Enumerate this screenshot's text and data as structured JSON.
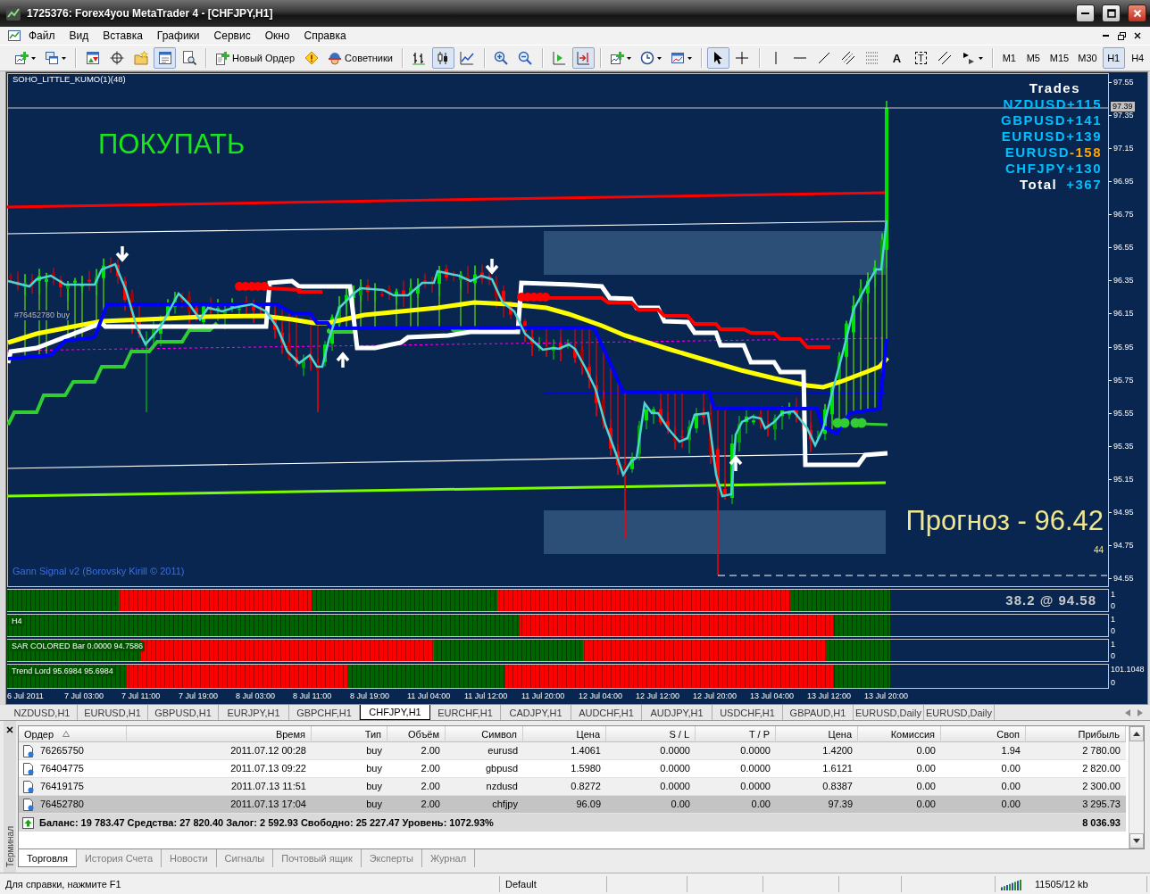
{
  "window": {
    "title": "1725376: Forex4you MetaTrader 4 - [CHFJPY,H1]"
  },
  "menu": [
    "Файл",
    "Вид",
    "Вставка",
    "Графики",
    "Сервис",
    "Окно",
    "Справка"
  ],
  "toolbar": {
    "panels": [
      {
        "kind": "market_watch",
        "selected": false
      },
      {
        "kind": "data_window",
        "selected": false
      },
      {
        "kind": "navigator",
        "selected": false
      },
      {
        "kind": "terminal",
        "selected": true
      },
      {
        "kind": "tester",
        "selected": false
      }
    ],
    "new_order": "Новый Ордер",
    "experts": "Советники",
    "chart_types": [
      {
        "kind": "bars",
        "selected": false
      },
      {
        "kind": "candles",
        "selected": true
      },
      {
        "kind": "line",
        "selected": false
      }
    ],
    "chart_options": [
      {
        "kind": "shift",
        "selected": false
      },
      {
        "kind": "autoscroll",
        "selected": true
      }
    ],
    "draw_tools": [
      {
        "kind": "cursor",
        "selected": true
      },
      {
        "kind": "crosshair",
        "selected": false
      },
      {
        "kind": "vline",
        "selected": false
      },
      {
        "kind": "hline",
        "selected": false
      },
      {
        "kind": "trendline",
        "selected": false
      },
      {
        "kind": "channel",
        "selected": false
      },
      {
        "kind": "fibo",
        "selected": false
      },
      {
        "kind": "text",
        "label": "A",
        "selected": false
      },
      {
        "kind": "label",
        "label": "T",
        "selected": false
      },
      {
        "kind": "hatch",
        "selected": false
      },
      {
        "kind": "shapes",
        "selected": false
      }
    ],
    "timeframes": [
      {
        "label": "M1",
        "selected": false
      },
      {
        "label": "M5",
        "selected": false
      },
      {
        "label": "M15",
        "selected": false
      },
      {
        "label": "M30",
        "selected": false
      },
      {
        "label": "H1",
        "selected": true
      },
      {
        "label": "H4",
        "selected": false
      }
    ]
  },
  "chart": {
    "indicator_title": "SOHO_LITTLE_KUMO(1)(48)",
    "signal": "ПОКУПАТЬ",
    "order_label": "#76452780 buy",
    "trades": {
      "title": "Trades",
      "rows": [
        {
          "pair": "NZDUSD",
          "value": "+115",
          "color": "#00bfff"
        },
        {
          "pair": "GBPUSD",
          "value": "+141",
          "color": "#00bfff"
        },
        {
          "pair": "EURUSD",
          "value": "+139",
          "color": "#00bfff"
        },
        {
          "pair": "EURUSD",
          "value": "-158",
          "color": "#ffa500"
        },
        {
          "pair": "CHFJPY",
          "value": "+130",
          "color": "#00bfff"
        }
      ],
      "total": {
        "label": "Total",
        "value": "+367"
      }
    },
    "forecast": "Прогноз - 96.42",
    "forecast_count": "44",
    "credit": "Gann Signal v2 (Borovsky Kirill © 2011)",
    "current_price": "97.39",
    "price_axis": [
      "97.55",
      "97.35",
      "97.15",
      "96.95",
      "96.75",
      "96.55",
      "96.35",
      "96.15",
      "95.95",
      "95.75",
      "95.55",
      "95.35",
      "95.15",
      "94.95",
      "94.75",
      "94.55"
    ]
  },
  "subwindows": [
    {
      "note": "38.2 @ 94.58",
      "axis": [
        "1",
        "0"
      ]
    },
    {
      "label": "H4",
      "axis": [
        "1",
        "0"
      ]
    },
    {
      "label": "SAR COLORED Bar 0.0000 94.7586",
      "axis": [
        "1",
        "0"
      ]
    },
    {
      "label": "Trend Lord 95.6984 95.6984",
      "axis": [
        "101.1048",
        "0"
      ]
    }
  ],
  "time_axis": [
    "6 Jul 2011",
    "7 Jul 03:00",
    "7 Jul 11:00",
    "7 Jul 19:00",
    "8 Jul 03:00",
    "8 Jul 11:00",
    "8 Jul 19:00",
    "11 Jul 04:00",
    "11 Jul 12:00",
    "11 Jul 20:00",
    "12 Jul 04:00",
    "12 Jul 12:00",
    "12 Jul 20:00",
    "13 Jul 04:00",
    "13 Jul 12:00",
    "13 Jul 20:00"
  ],
  "chart_tabs": [
    {
      "label": "NZDUSD,H1",
      "selected": false
    },
    {
      "label": "EURUSD,H1",
      "selected": false
    },
    {
      "label": "GBPUSD,H1",
      "selected": false
    },
    {
      "label": "EURJPY,H1",
      "selected": false
    },
    {
      "label": "GBPCHF,H1",
      "selected": false
    },
    {
      "label": "CHFJPY,H1",
      "selected": true
    },
    {
      "label": "EURCHF,H1",
      "selected": false
    },
    {
      "label": "CADJPY,H1",
      "selected": false
    },
    {
      "label": "AUDCHF,H1",
      "selected": false
    },
    {
      "label": "AUDJPY,H1",
      "selected": false
    },
    {
      "label": "USDCHF,H1",
      "selected": false
    },
    {
      "label": "GBPAUD,H1",
      "selected": false
    },
    {
      "label": "EURUSD,Daily",
      "selected": false
    },
    {
      "label": "EURUSD,Daily",
      "selected": false
    }
  ],
  "terminal": {
    "title": "Терминал",
    "columns": [
      {
        "label": "Ордер",
        "sorted": true
      },
      {
        "label": "Время",
        "sorted": false
      },
      {
        "label": "Тип",
        "sorted": false
      },
      {
        "label": "Объём",
        "sorted": false
      },
      {
        "label": "Символ",
        "sorted": false
      },
      {
        "label": "Цена",
        "sorted": false
      },
      {
        "label": "S / L",
        "sorted": false
      },
      {
        "label": "T / P",
        "sorted": false
      },
      {
        "label": "Цена",
        "sorted": false
      },
      {
        "label": "Комиссия",
        "sorted": false
      },
      {
        "label": "Своп",
        "sorted": false
      },
      {
        "label": "Прибыль",
        "sorted": false
      }
    ],
    "rows": [
      {
        "cells": [
          "76265750",
          "2011.07.12 00:28",
          "buy",
          "2.00",
          "eurusd",
          "1.4061",
          "0.0000",
          "0.0000",
          "1.4200",
          "0.00",
          "1.94",
          "2 780.00"
        ],
        "selected": false
      },
      {
        "cells": [
          "76404775",
          "2011.07.13 09:22",
          "buy",
          "2.00",
          "gbpusd",
          "1.5980",
          "0.0000",
          "0.0000",
          "1.6121",
          "0.00",
          "0.00",
          "2 820.00"
        ],
        "selected": false
      },
      {
        "cells": [
          "76419175",
          "2011.07.13 11:51",
          "buy",
          "2.00",
          "nzdusd",
          "0.8272",
          "0.0000",
          "0.0000",
          "0.8387",
          "0.00",
          "0.00",
          "2 300.00"
        ],
        "selected": false
      },
      {
        "cells": [
          "76452780",
          "2011.07.13 17:04",
          "buy",
          "2.00",
          "chfjpy",
          "96.09",
          "0.00",
          "0.00",
          "97.39",
          "0.00",
          "0.00",
          "3 295.73"
        ],
        "selected": true
      }
    ],
    "summary": "Баланс: 19 783.47 Средства: 27 820.40 Залог: 2 592.93 Свободно: 25 227.47 Уровень: 1072.93%",
    "total_profit": "8 036.93",
    "tabs": [
      {
        "label": "Торговля",
        "selected": true
      },
      {
        "label": "История Счета",
        "selected": false
      },
      {
        "label": "Новости",
        "selected": false
      },
      {
        "label": "Сигналы",
        "selected": false
      },
      {
        "label": "Почтовый ящик",
        "selected": false
      },
      {
        "label": "Эксперты",
        "selected": false
      },
      {
        "label": "Журнал",
        "selected": false
      }
    ]
  },
  "status_bar": {
    "help": "Для справки, нажмите F1",
    "profile": "Default",
    "traffic": "11505/12 kb"
  }
}
